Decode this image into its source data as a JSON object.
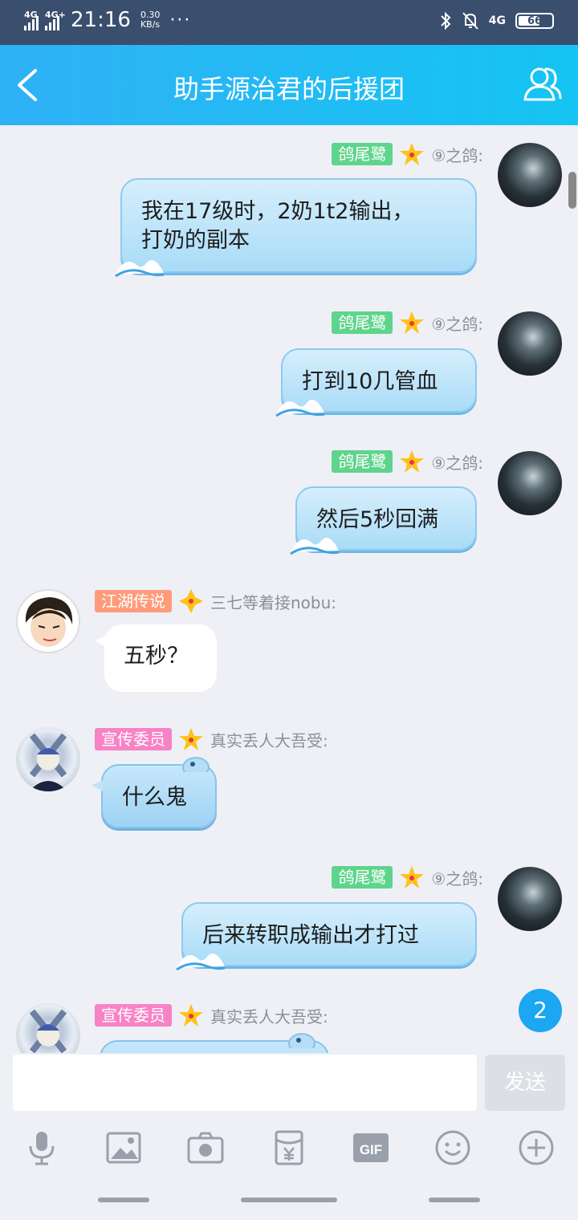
{
  "status_bar": {
    "network1": "4G",
    "network2": "4G+",
    "time": "21:16",
    "speed_value": "0.30",
    "speed_unit": "KB/s",
    "more": "···",
    "network_right": "4G",
    "battery": "66"
  },
  "nav": {
    "title": "助手源治君的后援团"
  },
  "messages": [
    {
      "side": "right",
      "badge": "鸽尾鹭",
      "badge_color": "#5fd48c",
      "sender": "⑨之鸽:",
      "text_lines": [
        "我在17级时，2奶1t2输出，",
        "打奶的副本"
      ]
    },
    {
      "side": "right",
      "badge": "鸽尾鹭",
      "badge_color": "#5fd48c",
      "sender": "⑨之鸽:",
      "text_lines": [
        "打到10几管血"
      ]
    },
    {
      "side": "right",
      "badge": "鸽尾鹭",
      "badge_color": "#5fd48c",
      "sender": "⑨之鸽:",
      "text_lines": [
        "然后5秒回满"
      ]
    },
    {
      "side": "left",
      "badge": "江湖传说",
      "badge_color": "#ff9b7a",
      "sender": "三七等着接nobu:",
      "text_lines": [
        "五秒？"
      ]
    },
    {
      "side": "left",
      "badge": "宣传委员",
      "badge_color": "#f783c6",
      "sender": "真实丢人大吾受:",
      "text_lines": [
        "什么鬼"
      ]
    },
    {
      "side": "right",
      "badge": "鸽尾鹭",
      "badge_color": "#5fd48c",
      "sender": "⑨之鸽:",
      "text_lines": [
        "后来转职成输出才打过"
      ]
    },
    {
      "side": "left",
      "badge": "宣传委员",
      "badge_color": "#f783c6",
      "sender": "真实丢人大吾受:",
      "text_lines": []
    }
  ],
  "unread_count": "2",
  "input": {
    "placeholder": "",
    "send_label": "发送"
  },
  "toolbar_icons": [
    "microphone-icon",
    "image-icon",
    "camera-icon",
    "red-packet-icon",
    "gif-icon",
    "emoji-icon",
    "plus-icon"
  ],
  "colors": {
    "nav_gradient_start": "#2fb1f5",
    "nav_gradient_end": "#15c4f3",
    "status_bar": "#3a4e6e",
    "background": "#eef0f6",
    "unread_badge": "#1ba7f1"
  }
}
